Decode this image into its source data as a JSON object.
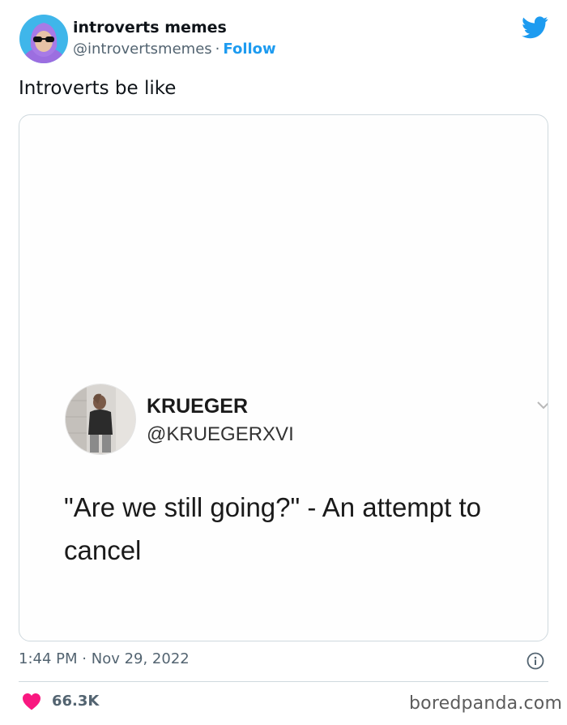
{
  "header": {
    "author_name": "introverts memes",
    "author_handle": "@introvertsmemes",
    "separator": "·",
    "follow_label": "Follow",
    "brand_icon": "twitter-bird-icon",
    "brand_color": "#1d9bf0"
  },
  "tweet": {
    "text": "Introverts be like"
  },
  "embedded_post": {
    "author_name": "KRUEGER",
    "author_handle": "@KRUEGERXVI",
    "text": "\"Are we still going?\" - An attempt to cancel",
    "menu_icon": "chevron-down-icon"
  },
  "meta": {
    "time": "1:44 PM",
    "separator": "·",
    "date": "Nov 29, 2022",
    "info_icon": "info-icon"
  },
  "engagement": {
    "likes": "66.3K",
    "like_icon": "heart-icon",
    "like_color": "#f91880"
  },
  "watermark": "boredpanda.com"
}
